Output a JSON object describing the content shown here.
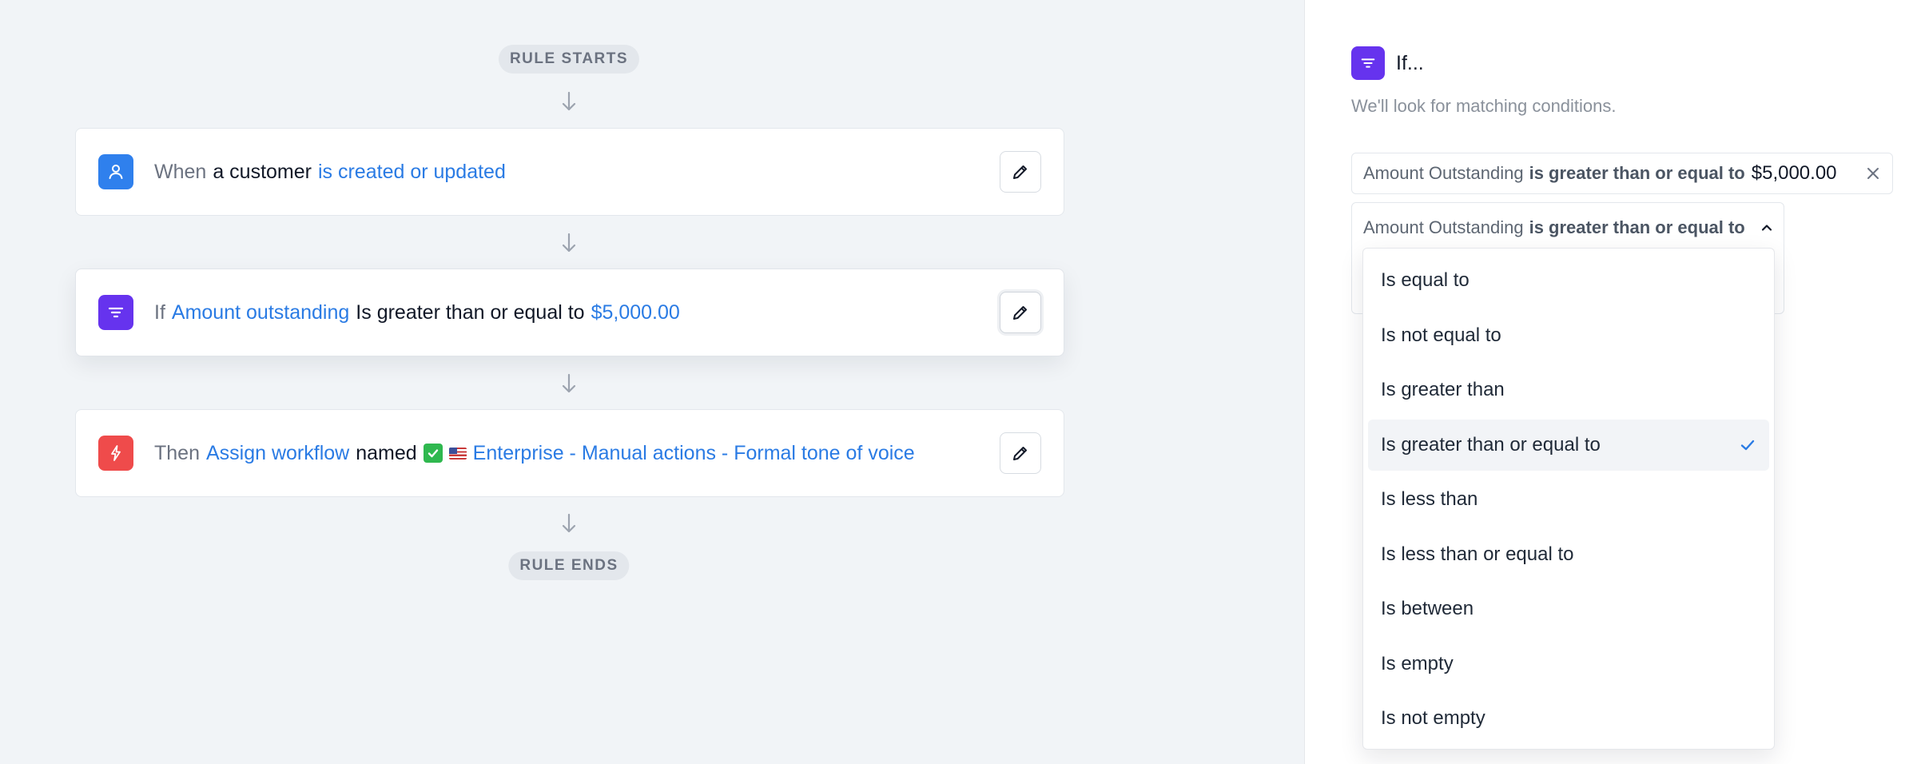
{
  "flow": {
    "start_label": "RULE STARTS",
    "end_label": "RULE ENDS",
    "trigger": {
      "prefix": "When",
      "subject": "a customer",
      "event": "is created or updated"
    },
    "condition": {
      "prefix": "If",
      "field": "Amount outstanding",
      "operator": "Is greater than or equal to",
      "value": "$5,000.00"
    },
    "action": {
      "prefix": "Then",
      "verb": "Assign workflow",
      "connector": "named",
      "target": "Enterprise - Manual actions - Formal tone of voice"
    }
  },
  "icons": {
    "trigger": "user-icon",
    "condition": "filter-icon",
    "action": "lightning-icon",
    "edit": "pencil-icon"
  },
  "colors": {
    "trigger_icon_bg": "#2f80ed",
    "condition_icon_bg": "#6633ee",
    "action_icon_bg": "#ef4b4b",
    "link": "#2a7be4",
    "check": "#2a7be4"
  },
  "panel": {
    "title": "If...",
    "subtitle": "We'll look for matching conditions.",
    "condition_chip": {
      "field": "Amount Outstanding",
      "operator": "is greater than or equal to",
      "value": "$5,000.00"
    },
    "editor": {
      "field": "Amount Outstanding",
      "operator": "is greater than or equal to"
    },
    "operator_options": [
      "Is equal to",
      "Is not equal to",
      "Is greater than",
      "Is greater than or equal to",
      "Is less than",
      "Is less than or equal to",
      "Is between",
      "Is empty",
      "Is not empty"
    ],
    "selected_operator": "Is greater than or equal to"
  }
}
